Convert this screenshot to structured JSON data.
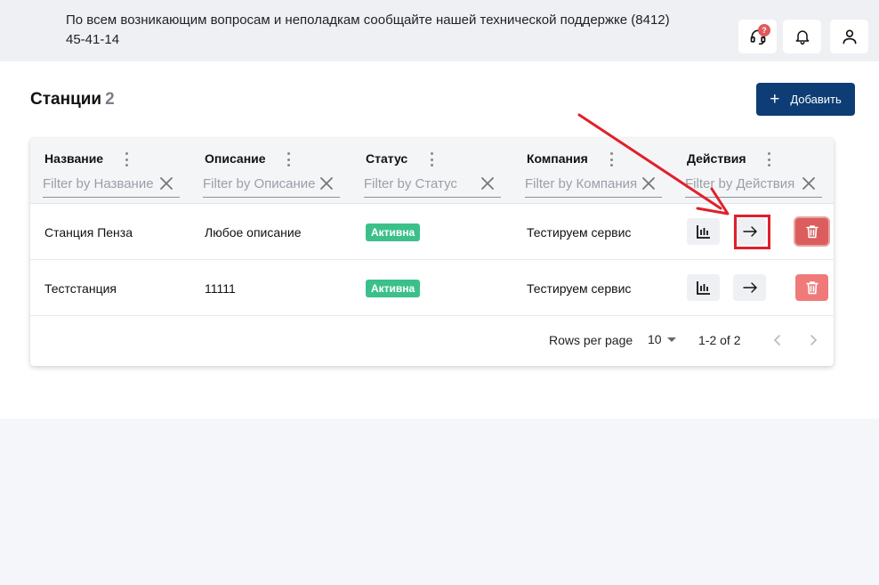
{
  "header": {
    "support_text": "По всем возникающим вопросам и неполадкам сообщайте нашей технической поддержке (8412) 45-41-14",
    "support_badge": "?",
    "icons": [
      "headset-icon",
      "bell-icon",
      "user-icon"
    ]
  },
  "page": {
    "title": "Станции",
    "count": "2",
    "add_label": "Добавить"
  },
  "table": {
    "columns": [
      {
        "label": "Название",
        "filter_placeholder": "Filter by Название"
      },
      {
        "label": "Описание",
        "filter_placeholder": "Filter by Описание"
      },
      {
        "label": "Статус",
        "filter_placeholder": "Filter by Статус"
      },
      {
        "label": "Компания",
        "filter_placeholder": "Filter by Компания"
      },
      {
        "label": "Действия",
        "filter_placeholder": "Filter by Действия"
      }
    ],
    "rows": [
      {
        "name": "Станция Пенза",
        "description": "Любое описание",
        "status": "Активна",
        "company": "Тестируем сервис"
      },
      {
        "name": "Тестстанция",
        "description": "11111",
        "status": "Активна",
        "company": "Тестируем сервис"
      }
    ]
  },
  "pagination": {
    "rows_per_page_label": "Rows per page",
    "rows_per_page_value": "10",
    "range": "1-2 of 2"
  },
  "colors": {
    "primary": "#0d3d74",
    "status_active": "#3cc08a",
    "danger": "#f07a7a",
    "annotation": "#e0202a"
  }
}
